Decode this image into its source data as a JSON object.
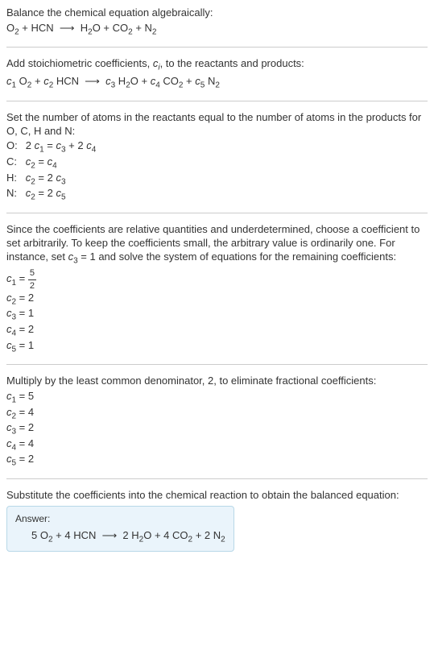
{
  "intro": {
    "line1": "Balance the chemical equation algebraically:",
    "equation": "O₂ + HCN ⟶ H₂O + CO₂ + N₂"
  },
  "step1": {
    "text": "Add stoichiometric coefficients, cᵢ, to the reactants and products:",
    "equation": "c₁ O₂ + c₂ HCN ⟶ c₃ H₂O + c₄ CO₂ + c₅ N₂"
  },
  "step2": {
    "text1": "Set the number of atoms in the reactants equal to the number of atoms in the products for O, C, H and N:",
    "rows": [
      {
        "label": "O:",
        "eq": "2 c₁ = c₃ + 2 c₄"
      },
      {
        "label": "C:",
        "eq": "c₂ = c₄"
      },
      {
        "label": "H:",
        "eq": "c₂ = 2 c₃"
      },
      {
        "label": "N:",
        "eq": "c₂ = 2 c₅"
      }
    ]
  },
  "step3": {
    "text": "Since the coefficients are relative quantities and underdetermined, choose a coefficient to set arbitrarily. To keep the coefficients small, the arbitrary value is ordinarily one. For instance, set c₃ = 1 and solve the system of equations for the remaining coefficients:",
    "c1_lhs": "c₁ = ",
    "c1_num": "5",
    "c1_den": "2",
    "c2": "c₂ = 2",
    "c3": "c₃ = 1",
    "c4": "c₄ = 2",
    "c5": "c₅ = 1"
  },
  "step4": {
    "text": "Multiply by the least common denominator, 2, to eliminate fractional coefficients:",
    "c1": "c₁ = 5",
    "c2": "c₂ = 4",
    "c3": "c₃ = 2",
    "c4": "c₄ = 4",
    "c5": "c₅ = 2"
  },
  "step5": {
    "text": "Substitute the coefficients into the chemical reaction to obtain the balanced equation:"
  },
  "answer": {
    "label": "Answer:",
    "equation": "5 O₂ + 4 HCN ⟶ 2 H₂O + 4 CO₂ + 2 N₂"
  }
}
